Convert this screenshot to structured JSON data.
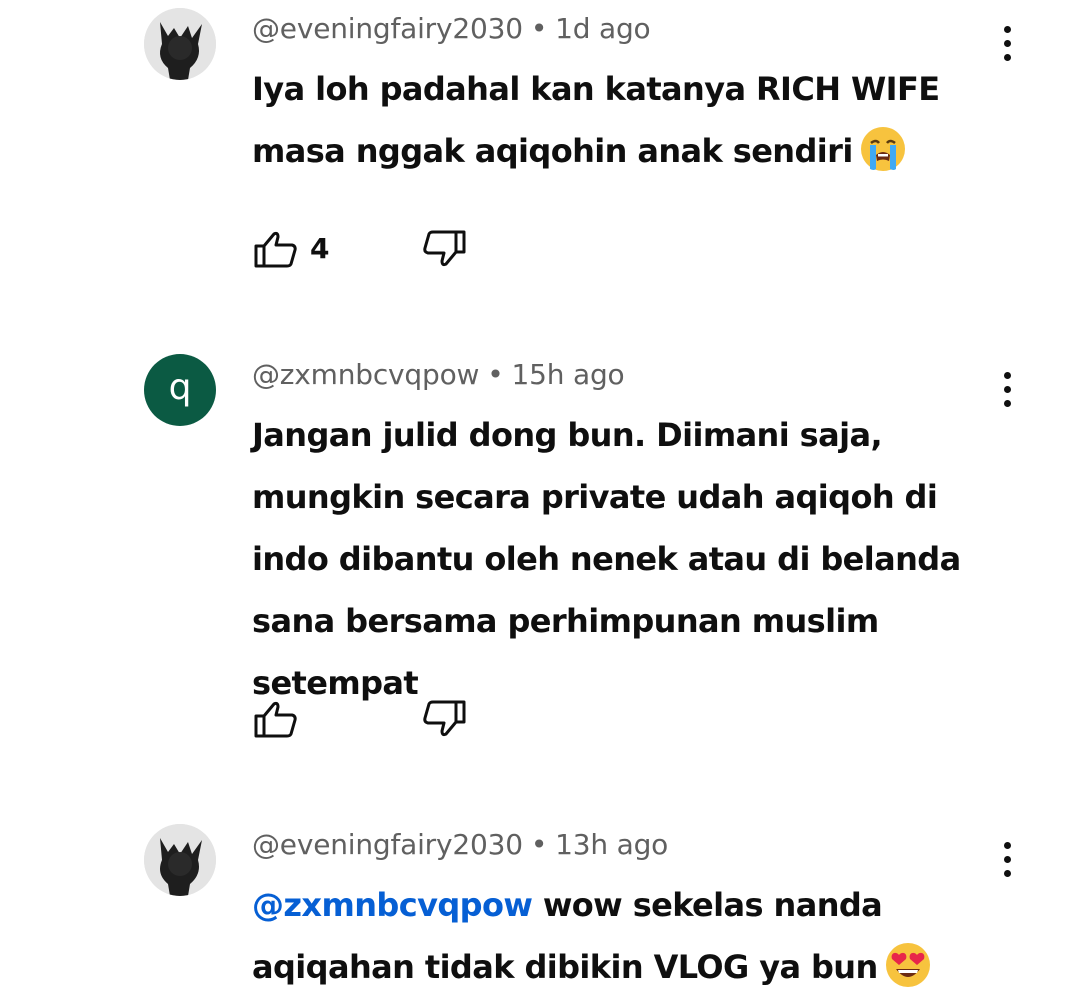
{
  "comments": [
    {
      "avatar": {
        "type": "image",
        "icon": "dark-silhouette-avatar"
      },
      "author": "@eveningfairy2030",
      "separator": "•",
      "time": "1d ago",
      "text": "Iya loh padahal kan katanya RICH WIFE masa nggak aqiqohin anak sendiri",
      "emoji": "loudly-crying-face-emoji",
      "like_count": "4",
      "icons": {
        "more": "more-vertical-icon",
        "like": "thumbs-up-icon",
        "dislike": "thumbs-down-icon"
      }
    },
    {
      "avatar": {
        "type": "letter",
        "letter": "q",
        "color": "#0b5a43"
      },
      "author": "@zxmnbcvqpow",
      "separator": "•",
      "time": "15h ago",
      "text": "Jangan julid dong bun. Diimani saja, mungkin secara private udah aqiqoh di indo dibantu oleh nenek atau di belanda sana bersama perhimpunan muslim setempat",
      "like_count": "",
      "icons": {
        "more": "more-vertical-icon",
        "like": "thumbs-up-icon",
        "dislike": "thumbs-down-icon"
      }
    },
    {
      "avatar": {
        "type": "image",
        "icon": "dark-silhouette-avatar"
      },
      "author": "@eveningfairy2030",
      "separator": "•",
      "time": "13h ago",
      "mention": "@zxmnbcvqpow",
      "text": " wow sekelas nanda aqiqahan tidak dibikin VLOG ya bun",
      "emoji": "heart-eyes-face-emoji",
      "icons": {
        "more": "more-vertical-icon"
      }
    }
  ],
  "colors": {
    "text_primary": "#0f0f0f",
    "text_secondary": "#606060",
    "mention": "#065fd4",
    "background": "#ffffff"
  }
}
